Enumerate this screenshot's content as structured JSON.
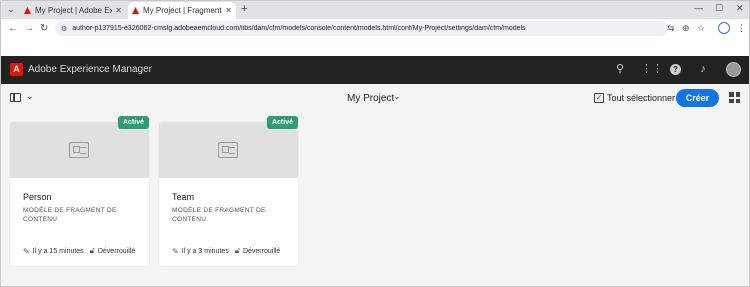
{
  "browser": {
    "tabs": [
      {
        "title": "My Project | Adobe Experience",
        "active": false
      },
      {
        "title": "My Project | Fragment de conte",
        "active": true
      }
    ],
    "new_tab": "+",
    "url": "author-p137915-e326062-cmstg.adobeaemcloud.com/libs/dam/cfm/models/console/content/models.html/conf/My-Project/settings/dam/cfm/models"
  },
  "app": {
    "title": "Adobe Experience Manager",
    "accent_color": "#eb1000"
  },
  "actionbar": {
    "breadcrumb": "My Project",
    "select_all_label": "Tout sélectionner",
    "create_label": "Créer",
    "primary_color": "#1473e6"
  },
  "cards": [
    {
      "title": "Person",
      "subtitle": "MODÈLE DE FRAGMENT DE CONTENU",
      "badge": "Activé",
      "modified": "Il y a 15 minutes",
      "lock_status": "Déverrouillé"
    },
    {
      "title": "Team",
      "subtitle": "MODÈLE DE FRAGMENT DE CONTENU",
      "badge": "Activé",
      "modified": "Il y a 3 minutes",
      "lock_status": "Déverrouillé"
    }
  ],
  "badge_color": "#2d9d78"
}
